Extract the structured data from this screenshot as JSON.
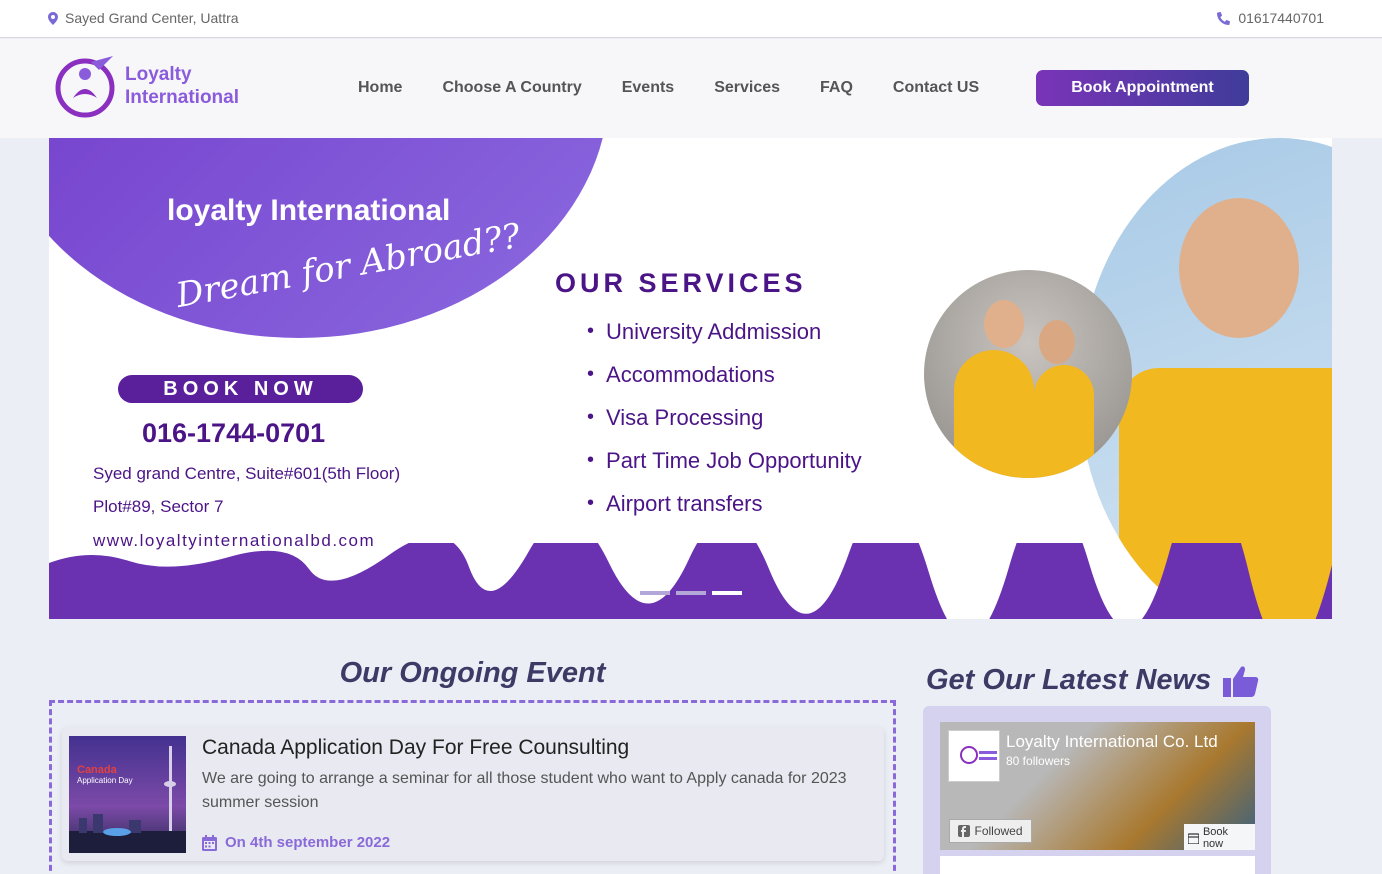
{
  "topbar": {
    "location": "Sayed Grand Center, Uattra",
    "phone": "01617440701"
  },
  "header": {
    "logo_line1": "Loyalty",
    "logo_line2": "International",
    "nav": [
      "Home",
      "Choose A Country",
      "Events",
      "Services",
      "FAQ",
      "Contact US"
    ],
    "cta": "Book Appointment"
  },
  "banner": {
    "brand": "loyalty International",
    "tagline": "Dream for Abroad??",
    "book_now": "BOOK NOW",
    "phone": "016-1744-0701",
    "address_line1": "Syed grand Centre, Suite#601(5th Floor)",
    "address_line2": "Plot#89,  Sector 7",
    "website": "www.loyaltyinternationalbd.com",
    "services_title": "OUR SERVICES",
    "services": [
      "University Addmission",
      "Accommodations",
      "Visa Processing",
      "Part Time Job Opportunity",
      "Airport transfers"
    ],
    "active_slide": 3
  },
  "event_section": {
    "title": "Our Ongoing Event",
    "card": {
      "thumb_country": "Canada",
      "thumb_sub": "Application Day",
      "name": "Canada Application Day For Free Counsulting",
      "description": "We are going to arrange a seminar for all those student who want to Apply canada for 2023 summer session",
      "date": "On 4th september 2022"
    }
  },
  "news_section": {
    "title": "Get Our Latest News",
    "fb": {
      "page_name": "Loyalty International Co. Ltd",
      "followers": "80 followers",
      "followed_label": "Followed",
      "book_label": "Book now"
    }
  },
  "colors": {
    "accent": "#7a34b8",
    "brand_purple": "#4b1487",
    "event_accent": "#8a69d8"
  }
}
